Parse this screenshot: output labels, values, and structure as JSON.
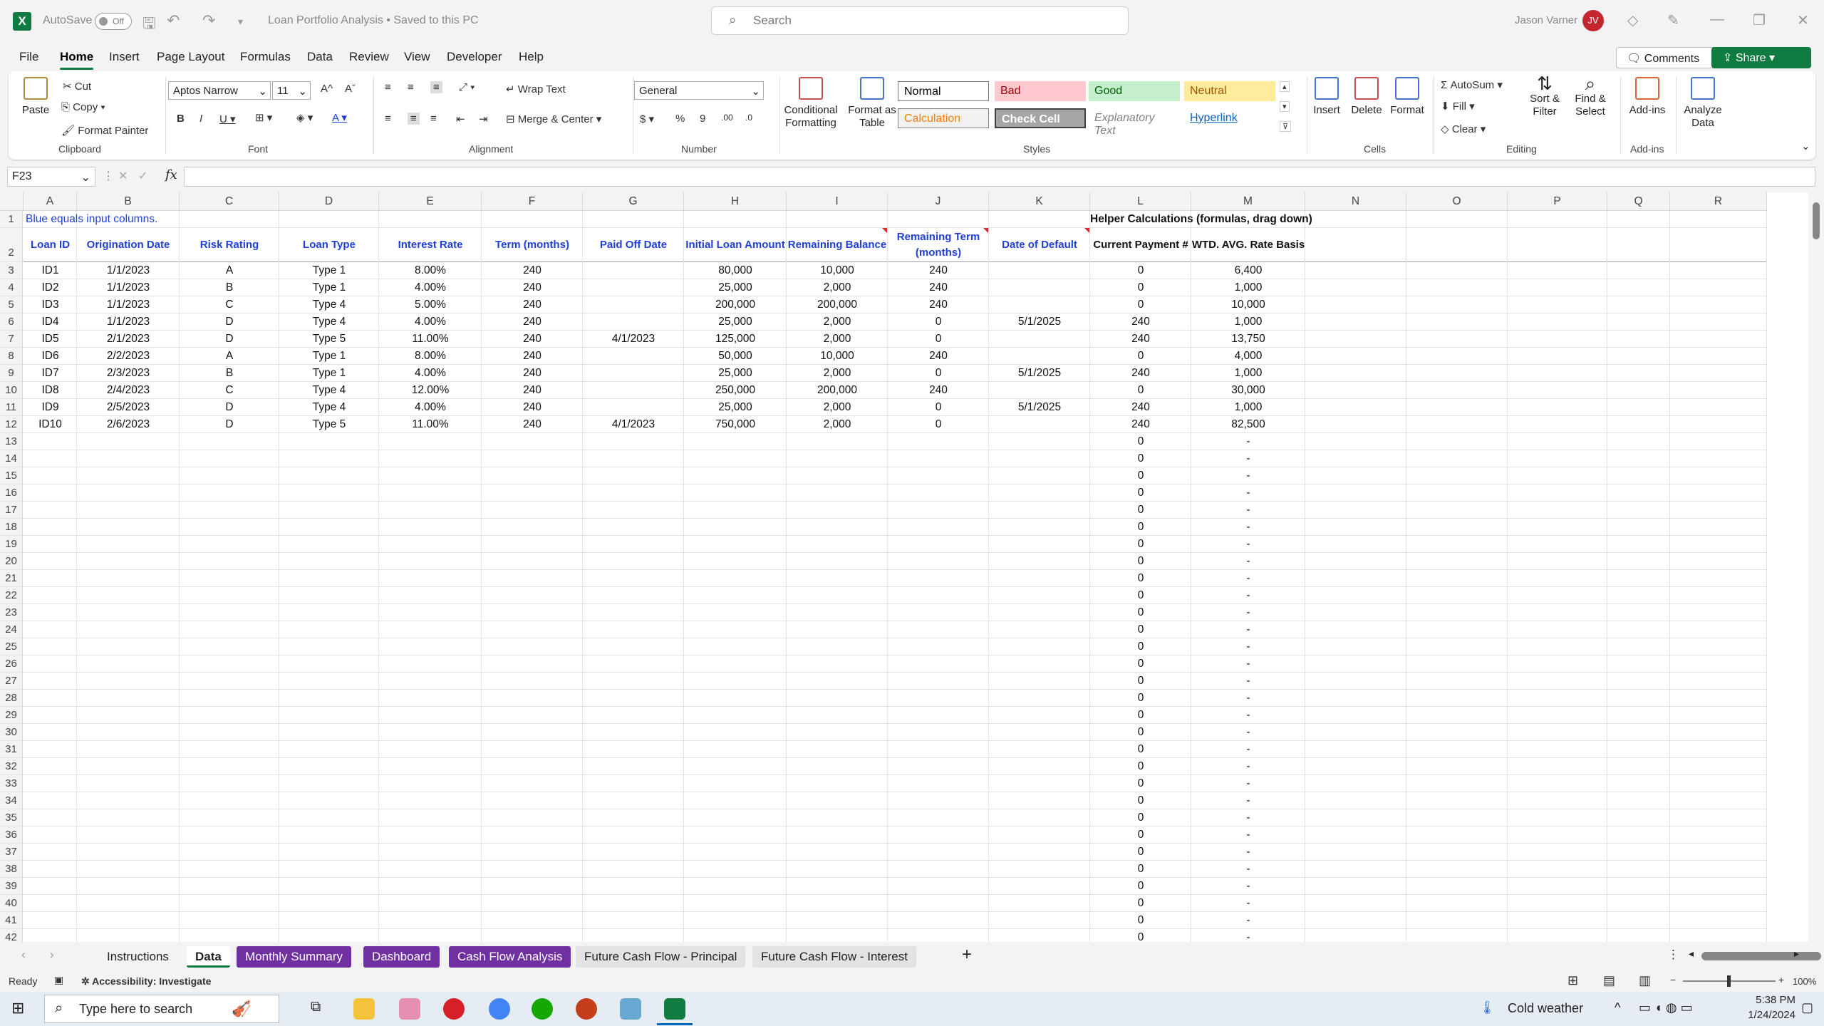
{
  "titlebar": {
    "autosave_label": "AutoSave",
    "autosave_state": "Off",
    "doc_title": "Loan Portfolio Analysis • Saved to this PC",
    "search_placeholder": "Search",
    "user_name": "Jason Varner",
    "user_initials": "JV"
  },
  "menu": {
    "tabs": [
      "File",
      "Home",
      "Insert",
      "Page Layout",
      "Formulas",
      "Data",
      "Review",
      "View",
      "Developer",
      "Help"
    ],
    "active": "Home",
    "comments": "Comments",
    "share": "Share"
  },
  "ribbon": {
    "clipboard": {
      "paste": "Paste",
      "cut": "Cut",
      "copy": "Copy",
      "format_painter": "Format Painter",
      "group": "Clipboard"
    },
    "font": {
      "name": "Aptos Narrow",
      "size": "11",
      "group": "Font"
    },
    "alignment": {
      "wrap": "Wrap Text",
      "merge": "Merge & Center",
      "group": "Alignment"
    },
    "number": {
      "format": "General",
      "group": "Number"
    },
    "styles": {
      "conditional": "Conditional Formatting",
      "format_table": "Format as Table",
      "group": "Styles",
      "cells": [
        {
          "label": "Normal",
          "bg": "#ffffff",
          "fg": "#000000"
        },
        {
          "label": "Bad",
          "bg": "#ffc7ce",
          "fg": "#9c0006"
        },
        {
          "label": "Good",
          "bg": "#c6efce",
          "fg": "#006100"
        },
        {
          "label": "Neutral",
          "bg": "#ffeb9c",
          "fg": "#9c5700"
        },
        {
          "label": "Calculation",
          "bg": "#f2f2f2",
          "fg": "#fa7d00"
        },
        {
          "label": "Check Cell",
          "bg": "#a5a5a5",
          "fg": "#ffffff"
        },
        {
          "label": "Explanatory Text",
          "bg": "#ffffff",
          "fg": "#7f7f7f"
        },
        {
          "label": "Hyperlink",
          "bg": "#ffffff",
          "fg": "#0563c1"
        }
      ]
    },
    "cells_grp": {
      "insert": "Insert",
      "delete": "Delete",
      "format": "Format",
      "group": "Cells"
    },
    "editing": {
      "autosum": "AutoSum",
      "fill": "Fill",
      "clear": "Clear",
      "sort": "Sort & Filter",
      "find": "Find & Select",
      "group": "Editing"
    },
    "addins": {
      "addins": "Add-ins",
      "analyze": "Analyze Data",
      "group": "Add-ins"
    }
  },
  "formula_bar": {
    "name_box": "F23",
    "fx": "fx",
    "value": ""
  },
  "sheet": {
    "columns": [
      "A",
      "B",
      "C",
      "D",
      "E",
      "F",
      "G",
      "H",
      "I",
      "J",
      "K",
      "L",
      "M",
      "N",
      "O",
      "P",
      "Q",
      "R"
    ],
    "row1_note": "Blue equals input columns.",
    "row1_helper": "Helper Calculations (formulas, drag down)",
    "headers": [
      "Loan ID",
      "Origination Date",
      "Risk Rating",
      "Loan Type",
      "Interest Rate",
      "Term (months)",
      "Paid Off Date",
      "Initial Loan Amount",
      "Remaining Balance",
      "Remaining Term (months)",
      "Date of Default",
      "Current Payment #",
      "WTD. AVG. Rate Basis"
    ],
    "rows": [
      [
        "ID1",
        "1/1/2023",
        "A",
        "Type 1",
        "8.00%",
        "240",
        "",
        "80,000",
        "10,000",
        "240",
        "",
        "0",
        "6,400"
      ],
      [
        "ID2",
        "1/1/2023",
        "B",
        "Type 1",
        "4.00%",
        "240",
        "",
        "25,000",
        "2,000",
        "240",
        "",
        "0",
        "1,000"
      ],
      [
        "ID3",
        "1/1/2023",
        "C",
        "Type 4",
        "5.00%",
        "240",
        "",
        "200,000",
        "200,000",
        "240",
        "",
        "0",
        "10,000"
      ],
      [
        "ID4",
        "1/1/2023",
        "D",
        "Type 4",
        "4.00%",
        "240",
        "",
        "25,000",
        "2,000",
        "0",
        "5/1/2025",
        "240",
        "1,000"
      ],
      [
        "ID5",
        "2/1/2023",
        "D",
        "Type 5",
        "11.00%",
        "240",
        "4/1/2023",
        "125,000",
        "2,000",
        "0",
        "",
        "240",
        "13,750"
      ],
      [
        "ID6",
        "2/2/2023",
        "A",
        "Type 1",
        "8.00%",
        "240",
        "",
        "50,000",
        "10,000",
        "240",
        "",
        "0",
        "4,000"
      ],
      [
        "ID7",
        "2/3/2023",
        "B",
        "Type 1",
        "4.00%",
        "240",
        "",
        "25,000",
        "2,000",
        "0",
        "5/1/2025",
        "240",
        "1,000"
      ],
      [
        "ID8",
        "2/4/2023",
        "C",
        "Type 4",
        "12.00%",
        "240",
        "",
        "250,000",
        "200,000",
        "240",
        "",
        "0",
        "30,000"
      ],
      [
        "ID9",
        "2/5/2023",
        "D",
        "Type 4",
        "4.00%",
        "240",
        "",
        "25,000",
        "2,000",
        "0",
        "5/1/2025",
        "240",
        "1,000"
      ],
      [
        "ID10",
        "2/6/2023",
        "D",
        "Type 5",
        "11.00%",
        "240",
        "4/1/2023",
        "750,000",
        "2,000",
        "0",
        "",
        "240",
        "82,500"
      ]
    ],
    "empty_l": "0",
    "empty_m": "-",
    "empty_row_start": 13,
    "empty_row_end": 42
  },
  "tabs": {
    "items": [
      {
        "label": "Instructions",
        "style": "plain"
      },
      {
        "label": "Data",
        "style": "active"
      },
      {
        "label": "Monthly Summary",
        "style": "purple"
      },
      {
        "label": "Dashboard",
        "style": "purple"
      },
      {
        "label": "Cash Flow Analysis",
        "style": "purple"
      },
      {
        "label": "Future Cash Flow - Principal",
        "style": "grey"
      },
      {
        "label": "Future Cash Flow - Interest",
        "style": "grey"
      }
    ],
    "add": "+"
  },
  "status": {
    "ready": "Ready",
    "accessibility": "Accessibility: Investigate",
    "zoom": "100%"
  },
  "taskbar": {
    "search_placeholder": "Type here to search",
    "weather": "Cold weather",
    "time": "5:38 PM",
    "date": "1/24/2024"
  }
}
